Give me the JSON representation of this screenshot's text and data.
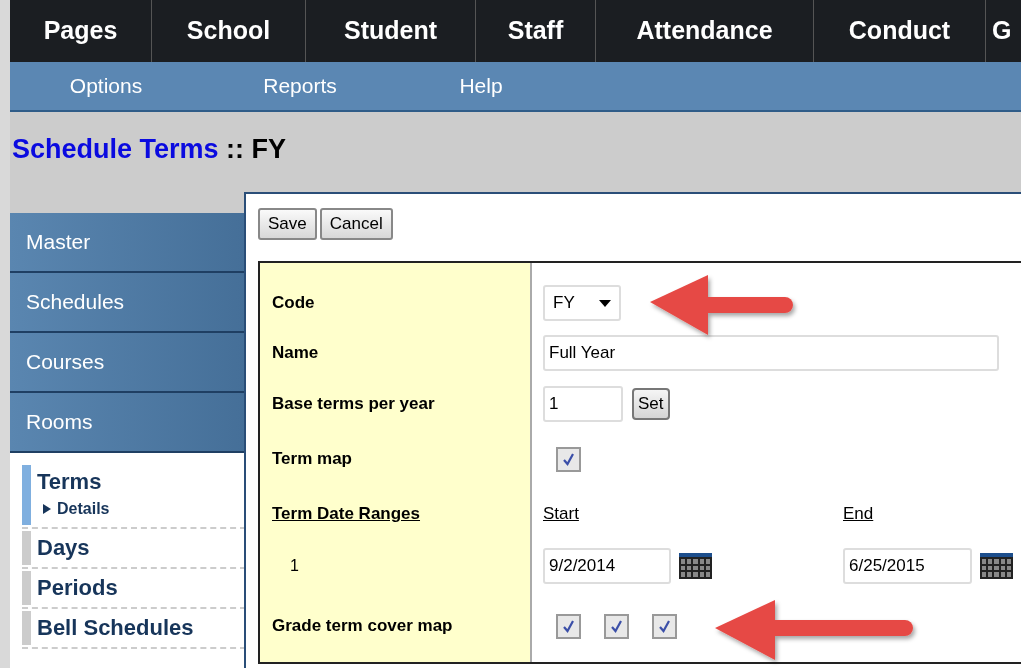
{
  "top_nav": [
    {
      "label": "Pages"
    },
    {
      "label": "School"
    },
    {
      "label": "Student"
    },
    {
      "label": "Staff"
    },
    {
      "label": "Attendance"
    },
    {
      "label": "Conduct"
    },
    {
      "label": "G"
    }
  ],
  "sub_nav": [
    "Options",
    "Reports",
    "Help"
  ],
  "page_title": {
    "main": "Schedule Terms",
    "suffix": ":: FY"
  },
  "sidebar": {
    "sections": [
      {
        "label": "Master"
      },
      {
        "label": "Schedules"
      },
      {
        "label": "Courses"
      },
      {
        "label": "Rooms"
      }
    ],
    "items": [
      {
        "label": "Terms",
        "selected": true,
        "children": [
          {
            "label": "Details"
          }
        ]
      },
      {
        "label": "Days",
        "selected": false
      },
      {
        "label": "Periods",
        "selected": false
      },
      {
        "label": "Bell Schedules",
        "selected": false
      }
    ]
  },
  "buttons": [
    "Save",
    "Cancel"
  ],
  "form": {
    "code": {
      "label": "Code",
      "value": "FY"
    },
    "name": {
      "label": "Name",
      "value": "Full Year"
    },
    "base_terms": {
      "label": "Base terms per year",
      "value": "1",
      "button": "Set"
    },
    "term_map": {
      "label": "Term map",
      "checked": true
    },
    "date_ranges": {
      "label": "Term Date Ranges",
      "start_header": "Start",
      "end_header": "End",
      "rows": [
        {
          "index": "1",
          "start": "9/2/2014",
          "end": "6/25/2015"
        }
      ]
    },
    "grade_cover_map": {
      "label": "Grade term cover map",
      "boxes": [
        {
          "checked": true
        },
        {
          "checked": true
        },
        {
          "checked": true
        }
      ]
    }
  }
}
